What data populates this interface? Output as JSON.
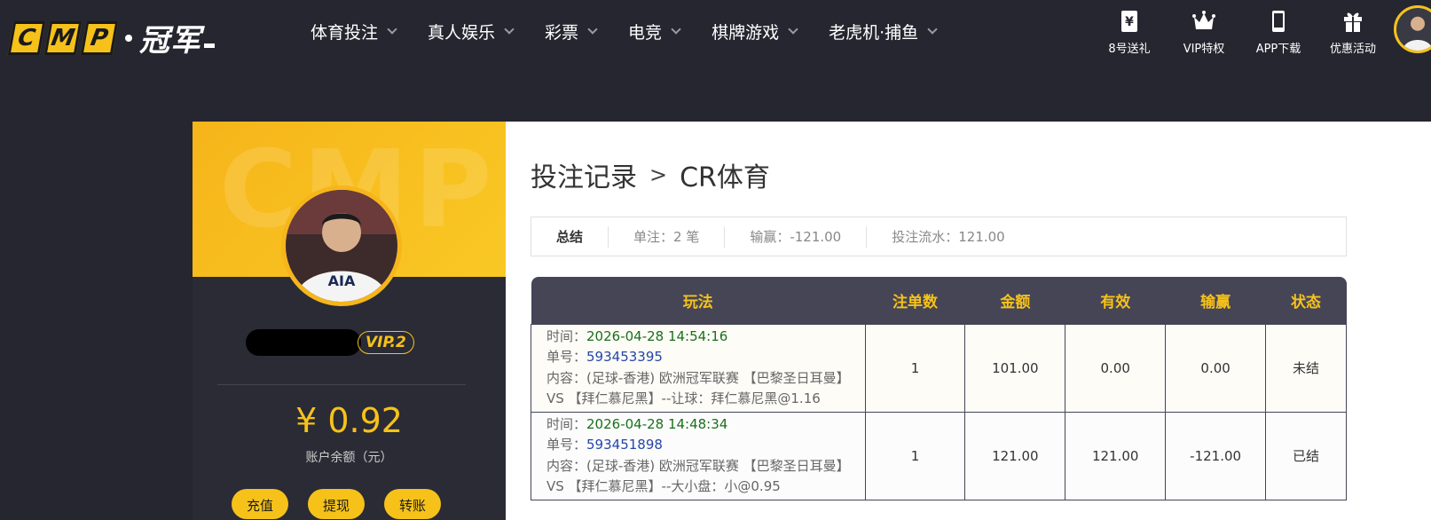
{
  "logo": {
    "letters": [
      "C",
      "M",
      "P"
    ],
    "cn": "冠军"
  },
  "nav": [
    {
      "label": "体育投注"
    },
    {
      "label": "真人娱乐"
    },
    {
      "label": "彩票"
    },
    {
      "label": "电竞"
    },
    {
      "label": "棋牌游戏"
    },
    {
      "label": "老虎机·捕鱼"
    }
  ],
  "top_icons": [
    {
      "label": "8号送礼",
      "icon": "yen-ticket-icon"
    },
    {
      "label": "VIP特权",
      "icon": "crown-icon"
    },
    {
      "label": "APP下载",
      "icon": "phone-icon"
    },
    {
      "label": "优惠活动",
      "icon": "gift-icon"
    }
  ],
  "sidebar": {
    "watermark": "CMP",
    "vip": "VIP.2",
    "balance": "¥ 0.92",
    "balance_label": "账户余额（元）",
    "buttons": [
      "充值",
      "提现",
      "转账"
    ]
  },
  "page": {
    "title": "投注记录",
    "sep": ">",
    "sub": "CR体育"
  },
  "summary": {
    "label": "总结",
    "count": "单注：2 笔",
    "winloss": "输赢：-121.00",
    "turnover": "投注流水：121.00"
  },
  "table": {
    "headers": [
      "玩法",
      "注单数",
      "金额",
      "有效",
      "输赢",
      "状态"
    ],
    "labels": {
      "time": "时间：",
      "order": "单号：",
      "content": "内容："
    },
    "rows": [
      {
        "time": "2026-04-28 14:54:16",
        "order": "593453395",
        "content": "(足球-香港) 欧洲冠军联赛 【巴黎圣日耳曼】 VS 【拜仁慕尼黑】--让球：拜仁慕尼黑@1.16",
        "count": "1",
        "amount": "101.00",
        "valid": "0.00",
        "winloss": "0.00",
        "status": "未结"
      },
      {
        "time": "2026-04-28 14:48:34",
        "order": "593451898",
        "content": "(足球-香港) 欧洲冠军联赛 【巴黎圣日耳曼】 VS 【拜仁慕尼黑】--大小盘：小@0.95",
        "count": "1",
        "amount": "121.00",
        "valid": "121.00",
        "winloss": "-121.00",
        "status": "已结"
      }
    ]
  },
  "colors": {
    "accent": "#f6c21a",
    "header_bg": "#262630",
    "table_head": "#454556",
    "negative": "#e02020",
    "time": "#1b6f1b",
    "order": "#2546a8"
  }
}
